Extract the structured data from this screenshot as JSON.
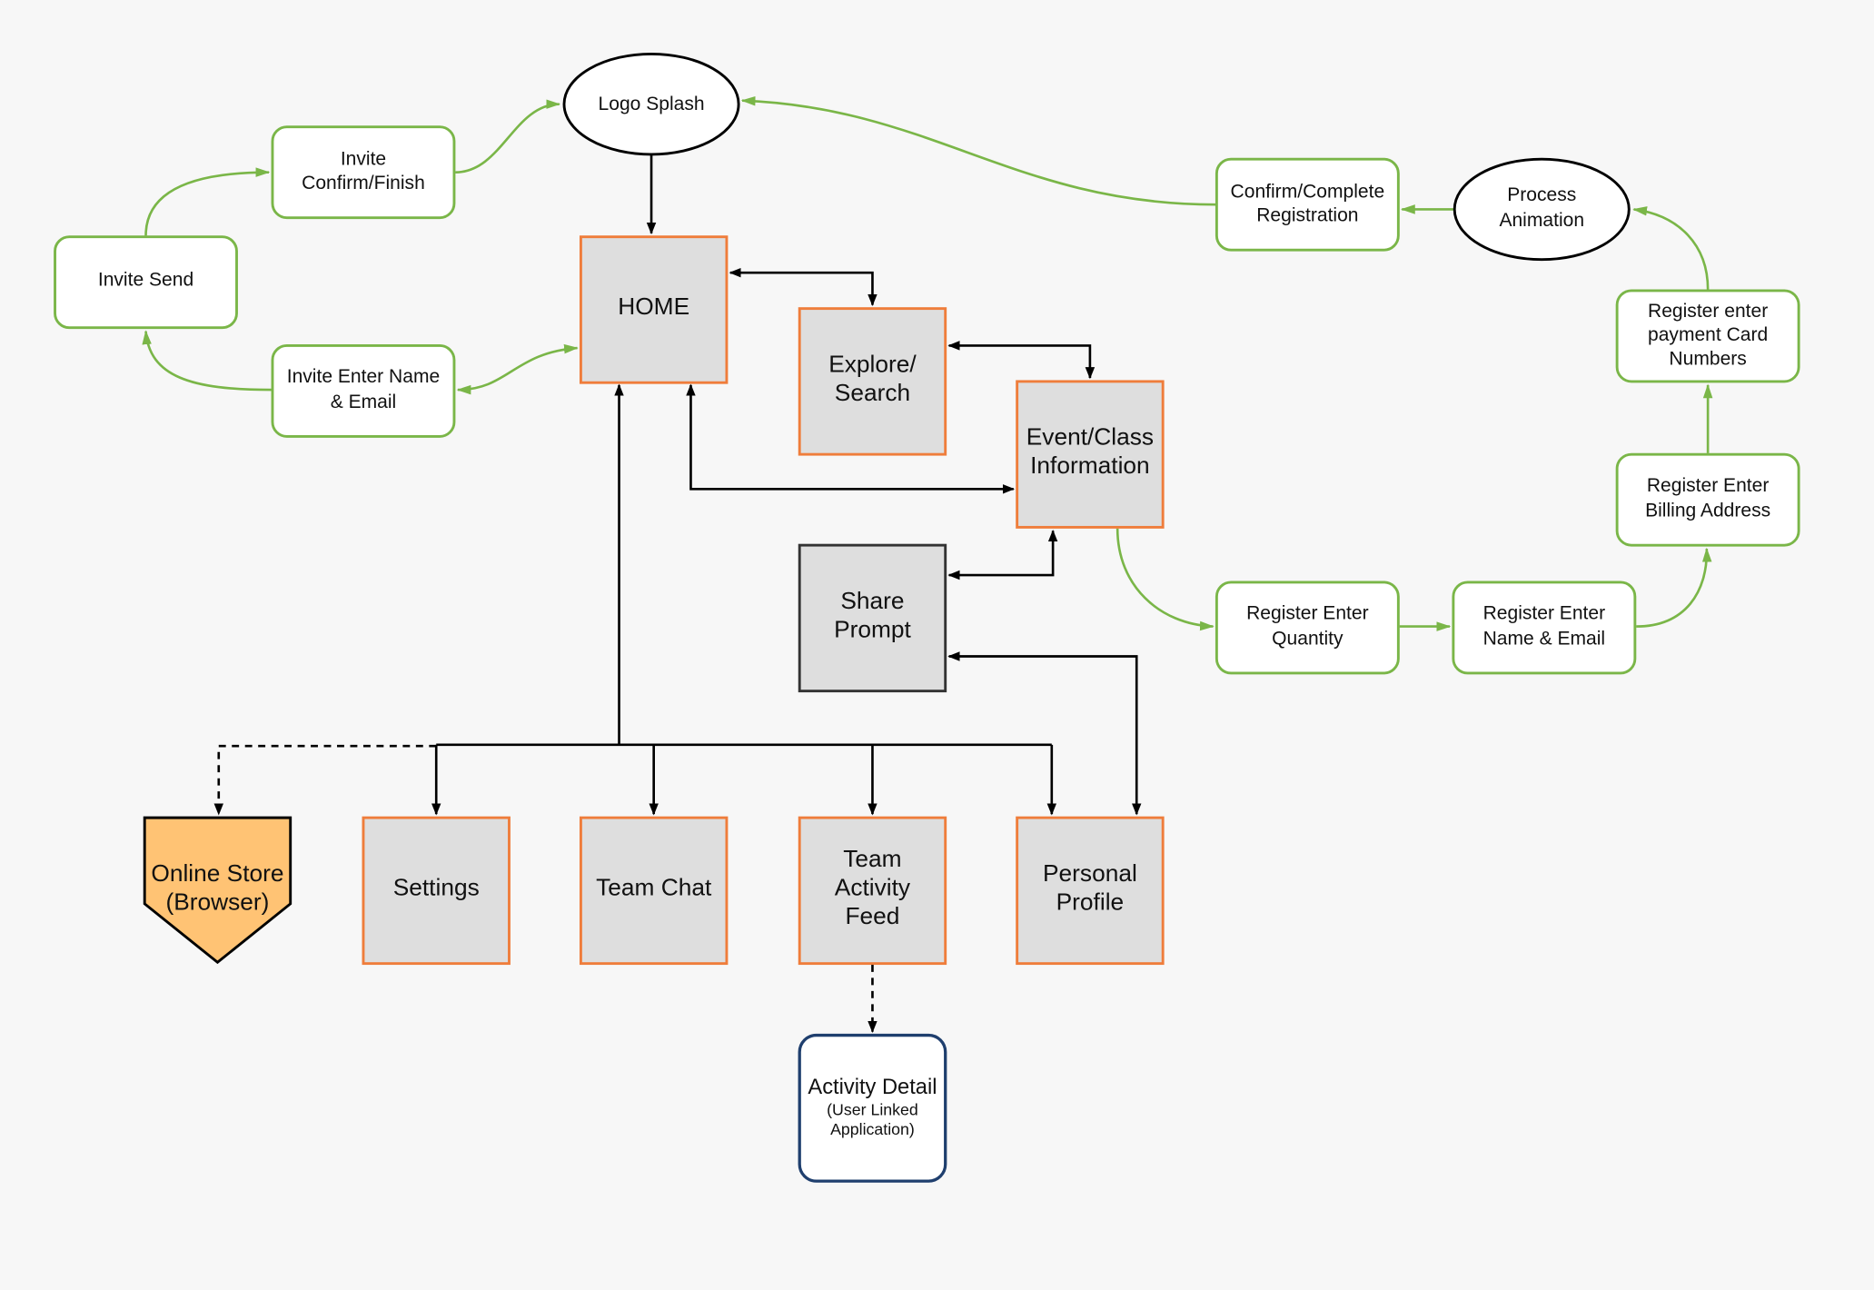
{
  "colors": {
    "process_fill": "#dedede",
    "process_border": "#ef7d3b",
    "flow_border": "#7ab648",
    "store_fill": "#ffc374",
    "detail_border": "#1f3f6e",
    "background": "#f7f7f7"
  },
  "nodes": {
    "logo_splash": [
      "Logo Splash"
    ],
    "invite_confirm": [
      "Invite",
      "Confirm/Finish"
    ],
    "invite_send": [
      "Invite Send"
    ],
    "invite_enter": [
      "Invite Enter Name",
      "& Email"
    ],
    "home": [
      "HOME"
    ],
    "explore": [
      "Explore/",
      "Search"
    ],
    "event": [
      "Event/Class",
      "Information"
    ],
    "share": [
      "Share",
      "Prompt"
    ],
    "confirm_registration": [
      "Confirm/Complete",
      "Registration"
    ],
    "process_animation": [
      "Process",
      "Animation"
    ],
    "register_payment": [
      "Register enter",
      "payment Card",
      "Numbers"
    ],
    "register_billing": [
      "Register Enter",
      "Billing Address"
    ],
    "register_quantity": [
      "Register Enter",
      "Quantity"
    ],
    "register_name": [
      "Register Enter",
      "Name & Email"
    ],
    "online_store": [
      "Online Store",
      "(Browser)"
    ],
    "settings": [
      "Settings"
    ],
    "team_chat": [
      "Team Chat"
    ],
    "team_activity": [
      "Team",
      "Activity",
      "Feed"
    ],
    "personal_profile": [
      "Personal",
      "Profile"
    ],
    "activity_detail": [
      "Activity Detail",
      "(User Linked",
      "Application)"
    ]
  }
}
